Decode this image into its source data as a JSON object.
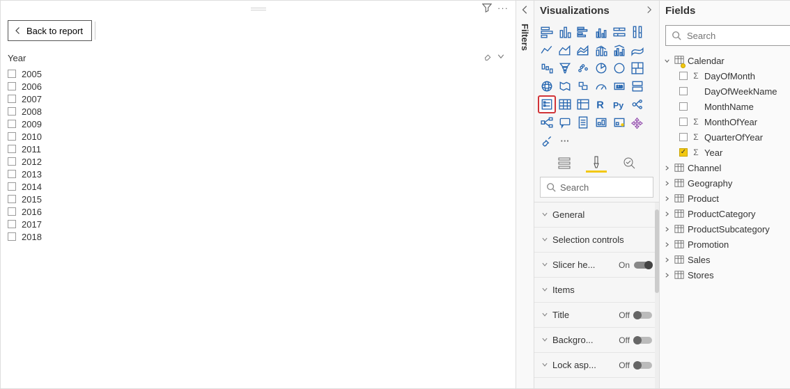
{
  "canvas": {
    "back_label": "Back to report",
    "slicer_title": "Year",
    "years": [
      "2005",
      "2006",
      "2007",
      "2008",
      "2009",
      "2010",
      "2011",
      "2012",
      "2013",
      "2014",
      "2015",
      "2016",
      "2017",
      "2018"
    ]
  },
  "filters_rail": {
    "label": "Filters"
  },
  "viz": {
    "title": "Visualizations",
    "search_placeholder": "Search",
    "gallery": [
      {
        "id": "stacked-bar",
        "selected": false
      },
      {
        "id": "stacked-column",
        "selected": false
      },
      {
        "id": "clustered-bar",
        "selected": false
      },
      {
        "id": "clustered-column",
        "selected": false
      },
      {
        "id": "100-stacked-bar",
        "selected": false
      },
      {
        "id": "100-stacked-column",
        "selected": false
      },
      {
        "id": "line",
        "selected": false
      },
      {
        "id": "area",
        "selected": false
      },
      {
        "id": "stacked-area",
        "selected": false
      },
      {
        "id": "line-stacked-column",
        "selected": false
      },
      {
        "id": "line-clustered-column",
        "selected": false
      },
      {
        "id": "ribbon",
        "selected": false
      },
      {
        "id": "waterfall",
        "selected": false
      },
      {
        "id": "funnel",
        "selected": false
      },
      {
        "id": "scatter",
        "selected": false
      },
      {
        "id": "pie",
        "selected": false
      },
      {
        "id": "donut",
        "selected": false
      },
      {
        "id": "treemap",
        "selected": false
      },
      {
        "id": "map",
        "selected": false
      },
      {
        "id": "filled-map",
        "selected": false
      },
      {
        "id": "shape-map",
        "selected": false
      },
      {
        "id": "gauge",
        "selected": false
      },
      {
        "id": "card",
        "selected": false
      },
      {
        "id": "multi-row-card",
        "selected": false
      },
      {
        "id": "slicer",
        "selected": true
      },
      {
        "id": "table",
        "selected": false
      },
      {
        "id": "matrix",
        "selected": false
      },
      {
        "id": "r-visual",
        "selected": false
      },
      {
        "id": "py-visual",
        "selected": false
      },
      {
        "id": "key-influencers",
        "selected": false
      },
      {
        "id": "decomposition-tree",
        "selected": false
      },
      {
        "id": "qna",
        "selected": false
      },
      {
        "id": "paginated-report",
        "selected": false
      },
      {
        "id": "power-apps",
        "selected": false
      },
      {
        "id": "power-automate",
        "selected": false
      },
      {
        "id": "get-more",
        "selected": false
      },
      {
        "id": "brush",
        "selected": false
      },
      {
        "id": "more-options",
        "selected": false
      }
    ],
    "format_items": [
      {
        "label": "General",
        "toggle": null
      },
      {
        "label": "Selection controls",
        "toggle": null
      },
      {
        "label": "Slicer he...",
        "toggle": "On"
      },
      {
        "label": "Items",
        "toggle": null
      },
      {
        "label": "Title",
        "toggle": "Off"
      },
      {
        "label": "Backgro...",
        "toggle": "Off"
      },
      {
        "label": "Lock asp...",
        "toggle": "Off"
      }
    ]
  },
  "fields": {
    "title": "Fields",
    "search_placeholder": "Search",
    "tables": [
      {
        "name": "Calendar",
        "expanded": true,
        "hasSelection": true,
        "columns": [
          {
            "name": "DayOfMonth",
            "sigma": true,
            "checked": false
          },
          {
            "name": "DayOfWeekName",
            "sigma": false,
            "checked": false
          },
          {
            "name": "MonthName",
            "sigma": false,
            "checked": false
          },
          {
            "name": "MonthOfYear",
            "sigma": true,
            "checked": false
          },
          {
            "name": "QuarterOfYear",
            "sigma": true,
            "checked": false
          },
          {
            "name": "Year",
            "sigma": true,
            "checked": true
          }
        ]
      },
      {
        "name": "Channel",
        "expanded": false
      },
      {
        "name": "Geography",
        "expanded": false
      },
      {
        "name": "Product",
        "expanded": false
      },
      {
        "name": "ProductCategory",
        "expanded": false
      },
      {
        "name": "ProductSubcategory",
        "expanded": false
      },
      {
        "name": "Promotion",
        "expanded": false
      },
      {
        "name": "Sales",
        "expanded": false
      },
      {
        "name": "Stores",
        "expanded": false
      }
    ]
  }
}
